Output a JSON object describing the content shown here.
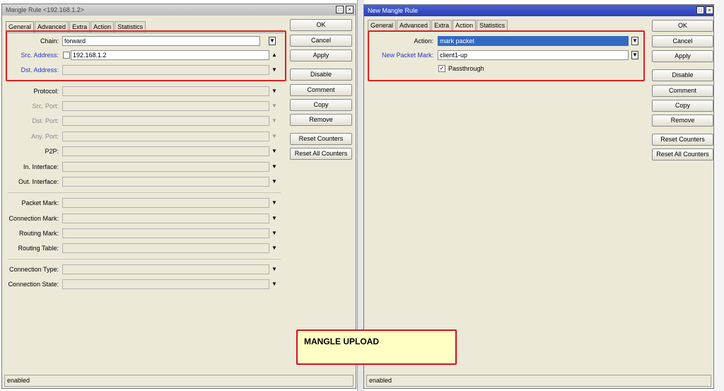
{
  "left_window": {
    "title": "Mangle Rule <192.168.1.2>",
    "tabs": [
      "General",
      "Advanced",
      "Extra",
      "Action",
      "Statistics"
    ],
    "active_tab": "General",
    "fields": {
      "chain": {
        "label": "Chain:",
        "value": "forward"
      },
      "src_address": {
        "label": "Src. Address:",
        "value": "192.168.1.2"
      },
      "dst_address": {
        "label": "Dst. Address:",
        "value": ""
      },
      "protocol": {
        "label": "Protocol:",
        "value": ""
      },
      "src_port": {
        "label": "Src. Port:",
        "value": ""
      },
      "dst_port": {
        "label": "Dst. Port:",
        "value": ""
      },
      "any_port": {
        "label": "Any. Port:",
        "value": ""
      },
      "p2p": {
        "label": "P2P:",
        "value": ""
      },
      "in_interface": {
        "label": "In. Interface:",
        "value": ""
      },
      "out_interface": {
        "label": "Out. Interface:",
        "value": ""
      },
      "packet_mark": {
        "label": "Packet Mark:",
        "value": ""
      },
      "connection_mark": {
        "label": "Connection Mark:",
        "value": ""
      },
      "routing_mark": {
        "label": "Routing Mark:",
        "value": ""
      },
      "routing_table": {
        "label": "Routing Table:",
        "value": ""
      },
      "connection_type": {
        "label": "Connection Type:",
        "value": ""
      },
      "connection_state": {
        "label": "Connection State:",
        "value": ""
      }
    },
    "buttons": {
      "ok": "OK",
      "cancel": "Cancel",
      "apply": "Apply",
      "disable": "Disable",
      "comment": "Comment",
      "copy": "Copy",
      "remove": "Remove",
      "reset_counters": "Reset Counters",
      "reset_all_counters": "Reset All Counters"
    },
    "status": "enabled"
  },
  "right_window": {
    "title": "New Mangle Rule",
    "tabs": [
      "General",
      "Advanced",
      "Extra",
      "Action",
      "Statistics"
    ],
    "active_tab": "Action",
    "fields": {
      "action": {
        "label": "Action:",
        "value": "mark packet"
      },
      "new_packet_mark": {
        "label": "New Packet Mark:",
        "value": "client1-up"
      },
      "passthrough": {
        "label": "Passthrough",
        "checked": true
      }
    },
    "buttons": {
      "ok": "OK",
      "cancel": "Cancel",
      "apply": "Apply",
      "disable": "Disable",
      "comment": "Comment",
      "copy": "Copy",
      "remove": "Remove",
      "reset_counters": "Reset Counters",
      "reset_all_counters": "Reset All Counters"
    },
    "status": "enabled"
  },
  "annotation": {
    "text": "MANGLE UPLOAD"
  },
  "colors": {
    "highlight": "#e02020",
    "note_bg": "#ffffc4",
    "active_title": "#2a3fb5",
    "link_label": "#2b35c9"
  }
}
